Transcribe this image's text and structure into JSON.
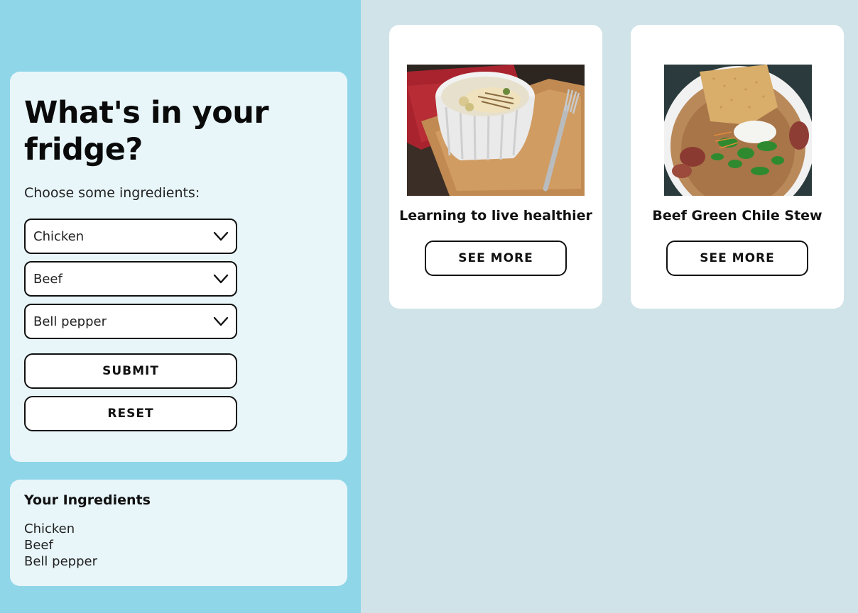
{
  "form": {
    "title": "What's in your fridge?",
    "subtitle": "Choose some ingredients:",
    "selects": [
      {
        "value": "Chicken"
      },
      {
        "value": "Beef"
      },
      {
        "value": "Bell pepper"
      }
    ],
    "submit_label": "SUBMIT",
    "reset_label": "RESET"
  },
  "ingredients": {
    "title": "Your Ingredients",
    "items": [
      "Chicken",
      "Beef",
      "Bell pepper"
    ]
  },
  "recipes": [
    {
      "name": "Learning to live healthier",
      "button_label": "SEE MORE",
      "image": "chicken-pasta-bowl-photo"
    },
    {
      "name": "Beef Green Chile Stew",
      "button_label": "SEE MORE",
      "image": "beef-chile-stew-photo"
    }
  ],
  "colors": {
    "left_background": "#8fd6e8",
    "right_background": "#d0e3e9",
    "panel_background": "#e8f6fa",
    "card_background": "#ffffff",
    "text": "#111111"
  }
}
